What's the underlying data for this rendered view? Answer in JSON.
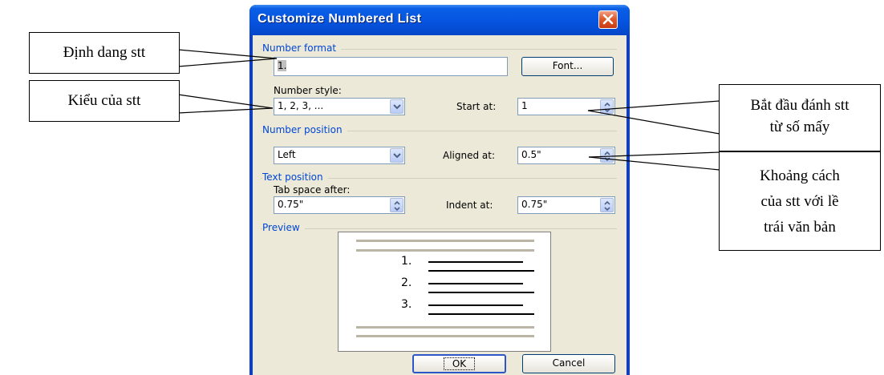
{
  "dialog": {
    "title": "Customize Numbered List",
    "number_format": {
      "group_label": "Number format",
      "value": "1.",
      "font_button": "Font..."
    },
    "number_style": {
      "label": "Number style:",
      "value": "1, 2, 3, ..."
    },
    "start_at": {
      "label": "Start at:",
      "value": "1"
    },
    "number_position": {
      "group_label": "Number position",
      "alignment": "Left",
      "aligned_at_label": "Aligned at:",
      "aligned_at_value": "0.5\""
    },
    "text_position": {
      "group_label": "Text position",
      "tab_space_label": "Tab space after:",
      "tab_space_value": "0.75\"",
      "indent_label": "Indent at:",
      "indent_value": "0.75\""
    },
    "preview": {
      "group_label": "Preview",
      "numbers": [
        "1.",
        "2.",
        "3."
      ]
    },
    "ok_button": "OK",
    "cancel_button": "Cancel"
  },
  "callouts": {
    "number_format": "Định dang stt",
    "number_style": "Kiểu của stt",
    "start_at": [
      "Bắt đầu đánh stt",
      "từ số mấy"
    ],
    "aligned_at": [
      "Khoảng cách",
      "của stt với lề",
      "trái văn bản"
    ]
  },
  "icons": [
    "close-icon",
    "dropdown-arrow-icon",
    "spin-arrows-icon"
  ]
}
